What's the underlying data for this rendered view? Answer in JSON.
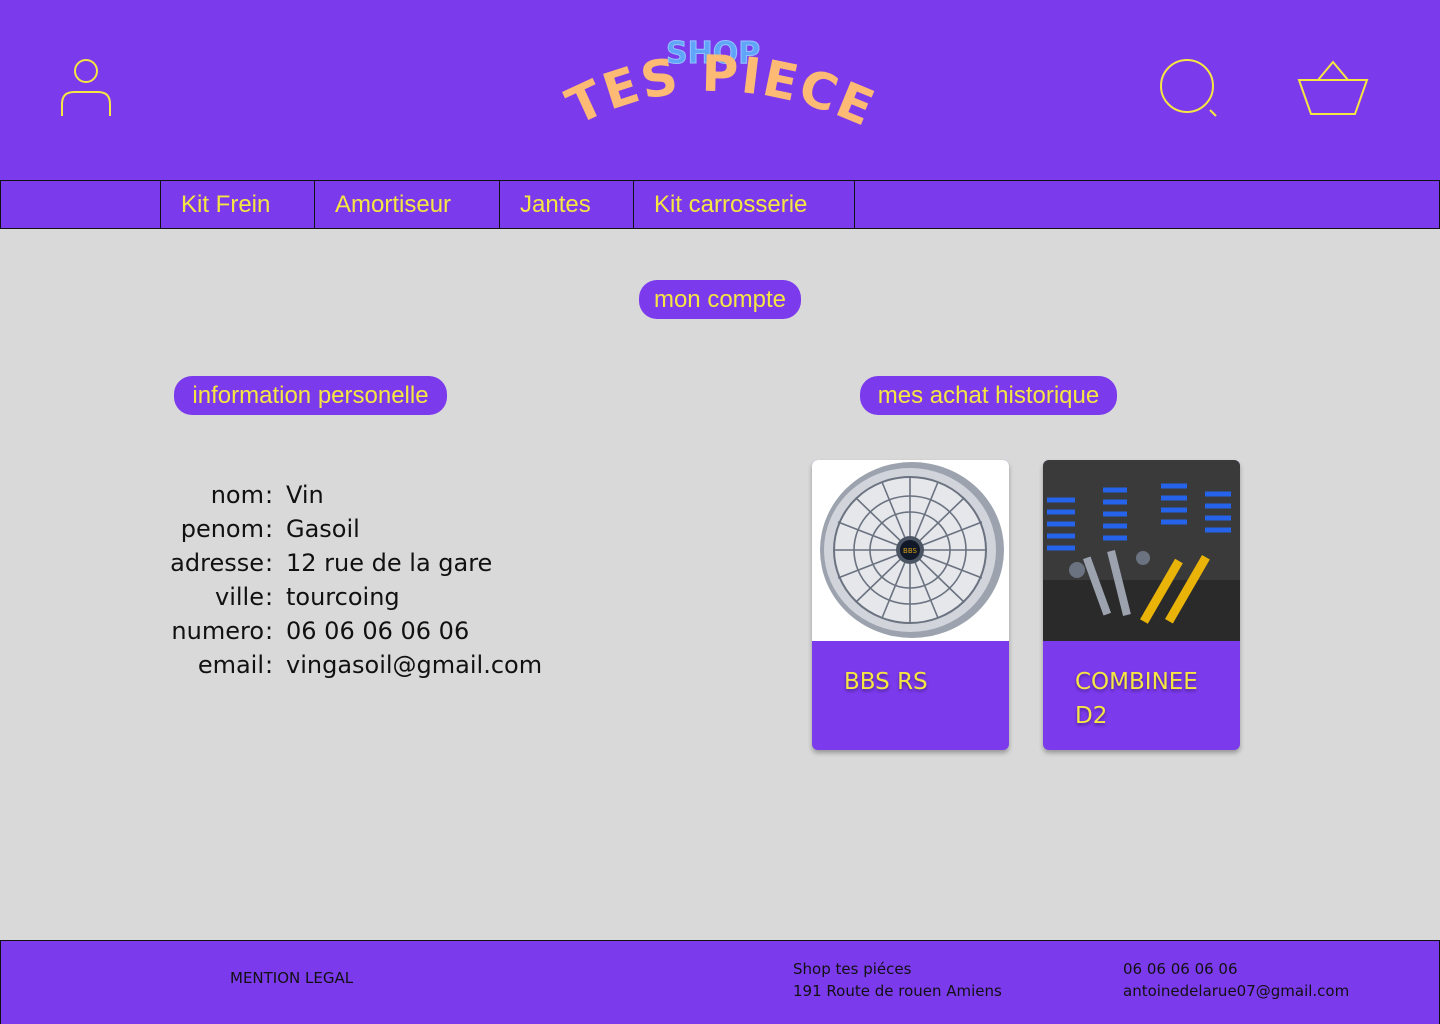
{
  "header": {
    "logo_top": "SHOP",
    "logo_main": "TES PIECE",
    "icons": [
      "user-icon",
      "search-icon",
      "cart-icon"
    ]
  },
  "nav": {
    "items": [
      {
        "label": "Kit Frein"
      },
      {
        "label": "Amortiseur"
      },
      {
        "label": "Jantes"
      },
      {
        "label": "Kit carrosserie"
      }
    ]
  },
  "page": {
    "title": "mon compte",
    "personal_heading": "information personelle",
    "history_heading": "mes achat historique"
  },
  "personal": {
    "fields": [
      {
        "label": "nom",
        "value": "Vin"
      },
      {
        "label": "penom",
        "value": "Gasoil"
      },
      {
        "label": "adresse",
        "value": "12 rue de la gare"
      },
      {
        "label": "ville",
        "value": "tourcoing"
      },
      {
        "label": "numero",
        "value": "06 06 06 06 06"
      },
      {
        "label": "email",
        "value": "vingasoil@gmail.com"
      }
    ],
    "separator": ":"
  },
  "history": {
    "products": [
      {
        "name": "BBS RS",
        "image": "wheel-rim-image"
      },
      {
        "name": "COMBINEE D2",
        "image": "coilover-kit-image"
      }
    ]
  },
  "footer": {
    "legal": "MENTION LEGAL",
    "shop_name": "Shop tes piéces",
    "shop_address": "191 Route de rouen Amiens",
    "phone": "06 06 06 06 06",
    "email": "antoinedelarue07@gmail.com"
  },
  "colors": {
    "brand_purple": "#7c3aed",
    "accent_yellow": "#f5e642",
    "background": "#d9d9d9",
    "logo_blue": "#60a5fa",
    "logo_orange": "#fdba74"
  }
}
